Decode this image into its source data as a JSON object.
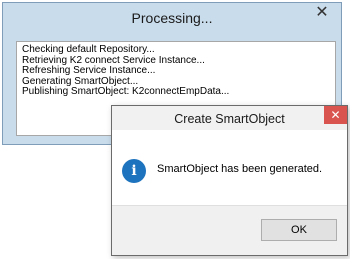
{
  "processing_window": {
    "title": "Processing...",
    "close_glyph": "✕",
    "log_lines": [
      "Checking default Repository...",
      "Retrieving K2 connect Service Instance...",
      "Refreshing Service Instance...",
      "Generating SmartObject...",
      "Publishing SmartObject: K2connectEmpData..."
    ]
  },
  "dialog": {
    "title": "Create SmartObject",
    "close_glyph": "✕",
    "icon": "info-icon",
    "icon_glyph": "i",
    "message": "SmartObject has been generated.",
    "ok_label": "OK"
  },
  "colors": {
    "processing_bg": "#c9dceb",
    "close_red": "#d9534f",
    "info_blue": "#1e73be"
  }
}
